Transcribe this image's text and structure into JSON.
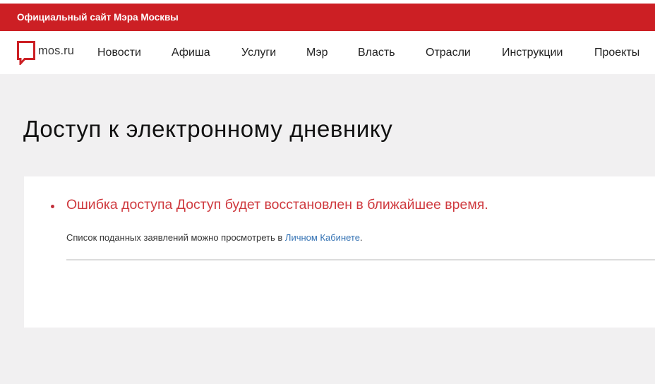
{
  "header": {
    "title": "Официальный сайт Мэра Москвы"
  },
  "nav": {
    "logo_text": "mos.ru",
    "items": [
      {
        "label": "Новости"
      },
      {
        "label": "Афиша"
      },
      {
        "label": "Услуги"
      },
      {
        "label": "Мэр"
      },
      {
        "label": "Власть"
      },
      {
        "label": "Отрасли"
      },
      {
        "label": "Инструкции"
      },
      {
        "label": "Проекты"
      }
    ]
  },
  "main": {
    "page_title": "Доступ к электронному дневнику",
    "error_message": "Ошибка доступа Доступ будет восстановлен в ближайшее время.",
    "info_text": "Список поданных заявлений можно просмотреть в ",
    "info_link": "Личном Кабинете",
    "info_end": "."
  },
  "colors": {
    "brand_red": "#cc1f24",
    "error_red": "#cf3a3f",
    "link_blue": "#3573b4",
    "page_bg": "#f1f0f1"
  },
  "icons": {
    "logo": "speech-bubble-icon"
  }
}
